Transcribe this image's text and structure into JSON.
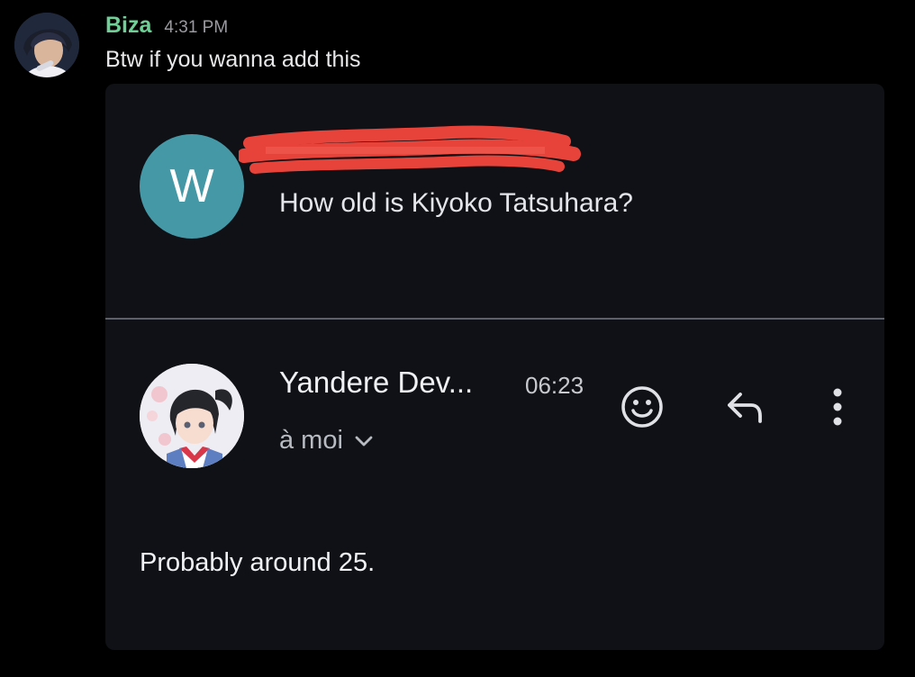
{
  "message": {
    "author": "Biza",
    "timestamp": "4:31 PM",
    "text": "Btw if you wanna add this",
    "author_color": "#6fcf97"
  },
  "attachment": {
    "original_email": {
      "avatar_letter": "W",
      "avatar_color": "#4598a6",
      "subject": "How old is Kiyoko Tatsuhara?"
    },
    "reply": {
      "sender": "Yandere Dev...",
      "time": "06:23",
      "recipient": "à moi",
      "body": "Probably around 25."
    },
    "icons": [
      "chevron-down-icon",
      "emoji-icon",
      "reply-icon",
      "more-vert-icon"
    ]
  }
}
